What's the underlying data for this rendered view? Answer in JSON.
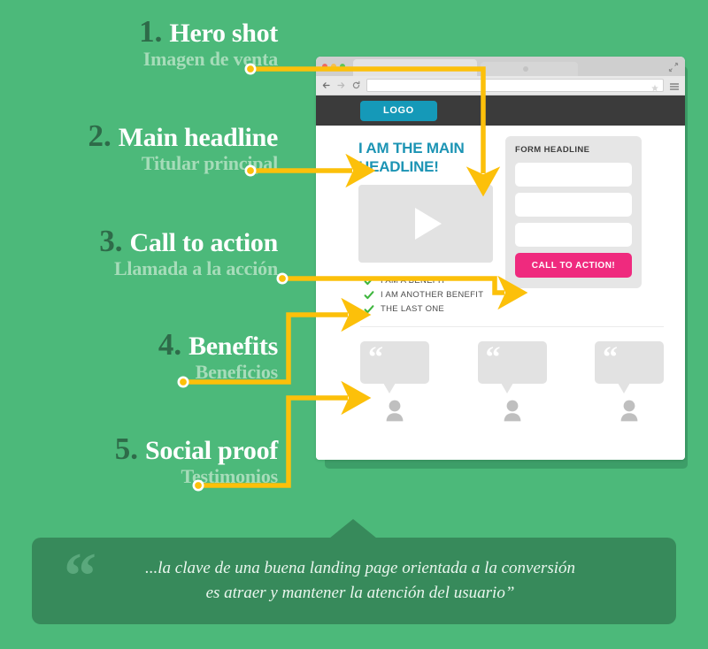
{
  "palette": {
    "bg_green": "#4cb97a",
    "dark_green": "#2e6b49",
    "shadow_green": "#3d9e68",
    "banner_green": "#378a5b",
    "muted_green": "#a6dcb9",
    "connector_yellow": "#fcc00a",
    "cta_pink": "#ef2a7e",
    "logo_teal": "#1599b8",
    "headline_teal": "#1c94b4",
    "check_green": "#3fb63f",
    "browser_dark": "#3b3b3b",
    "placeholder_gray": "#e2e2e2"
  },
  "steps": [
    {
      "num": "1.",
      "en": "Hero shot",
      "es": "Imagen de venta"
    },
    {
      "num": "2.",
      "en": "Main headline",
      "es": "Titular principal"
    },
    {
      "num": "3.",
      "en": "Call to action",
      "es": "Llamada a la acción"
    },
    {
      "num": "4.",
      "en": "Benefits",
      "es": "Beneficios"
    },
    {
      "num": "5.",
      "en": "Social proof",
      "es": "Testimonios"
    }
  ],
  "browser": {
    "traffic_lights": [
      "close-red",
      "minimize-yellow",
      "maximize-green"
    ],
    "nav_icons": [
      "back-arrow-icon",
      "forward-arrow-icon",
      "reload-icon"
    ],
    "url_value": "",
    "url_placeholder": "",
    "star_icon": "bookmark-star-icon",
    "menu_icon": "hamburger-menu-icon",
    "resize_icon": "resize-diagonal-icon"
  },
  "landing": {
    "logo_label": "LOGO",
    "main_headline": "I AM THE MAIN HEADLINE!",
    "video_icon": "play-triangle-icon",
    "form": {
      "headline": "FORM HEADLINE",
      "fields": [
        {
          "name": "form-field-1",
          "value": "",
          "placeholder": ""
        },
        {
          "name": "form-field-2",
          "value": "",
          "placeholder": ""
        },
        {
          "name": "form-field-3",
          "value": "",
          "placeholder": ""
        }
      ],
      "cta_label": "CALL TO ACTION!"
    },
    "benefits": [
      "I AM A BENEFIT",
      "I AM ANOTHER BENEFIT",
      "THE LAST ONE"
    ],
    "testimonials": [
      {
        "quote_mark": "“",
        "avatar": "person-avatar-icon"
      },
      {
        "quote_mark": "“",
        "avatar": "person-avatar-icon"
      },
      {
        "quote_mark": "“",
        "avatar": "person-avatar-icon"
      }
    ]
  },
  "quote_banner": {
    "mark": "“",
    "line1": "...la clave de una buena landing page orientada a la conversión",
    "line2": "es atraer y mantener la atención del usuario”"
  }
}
